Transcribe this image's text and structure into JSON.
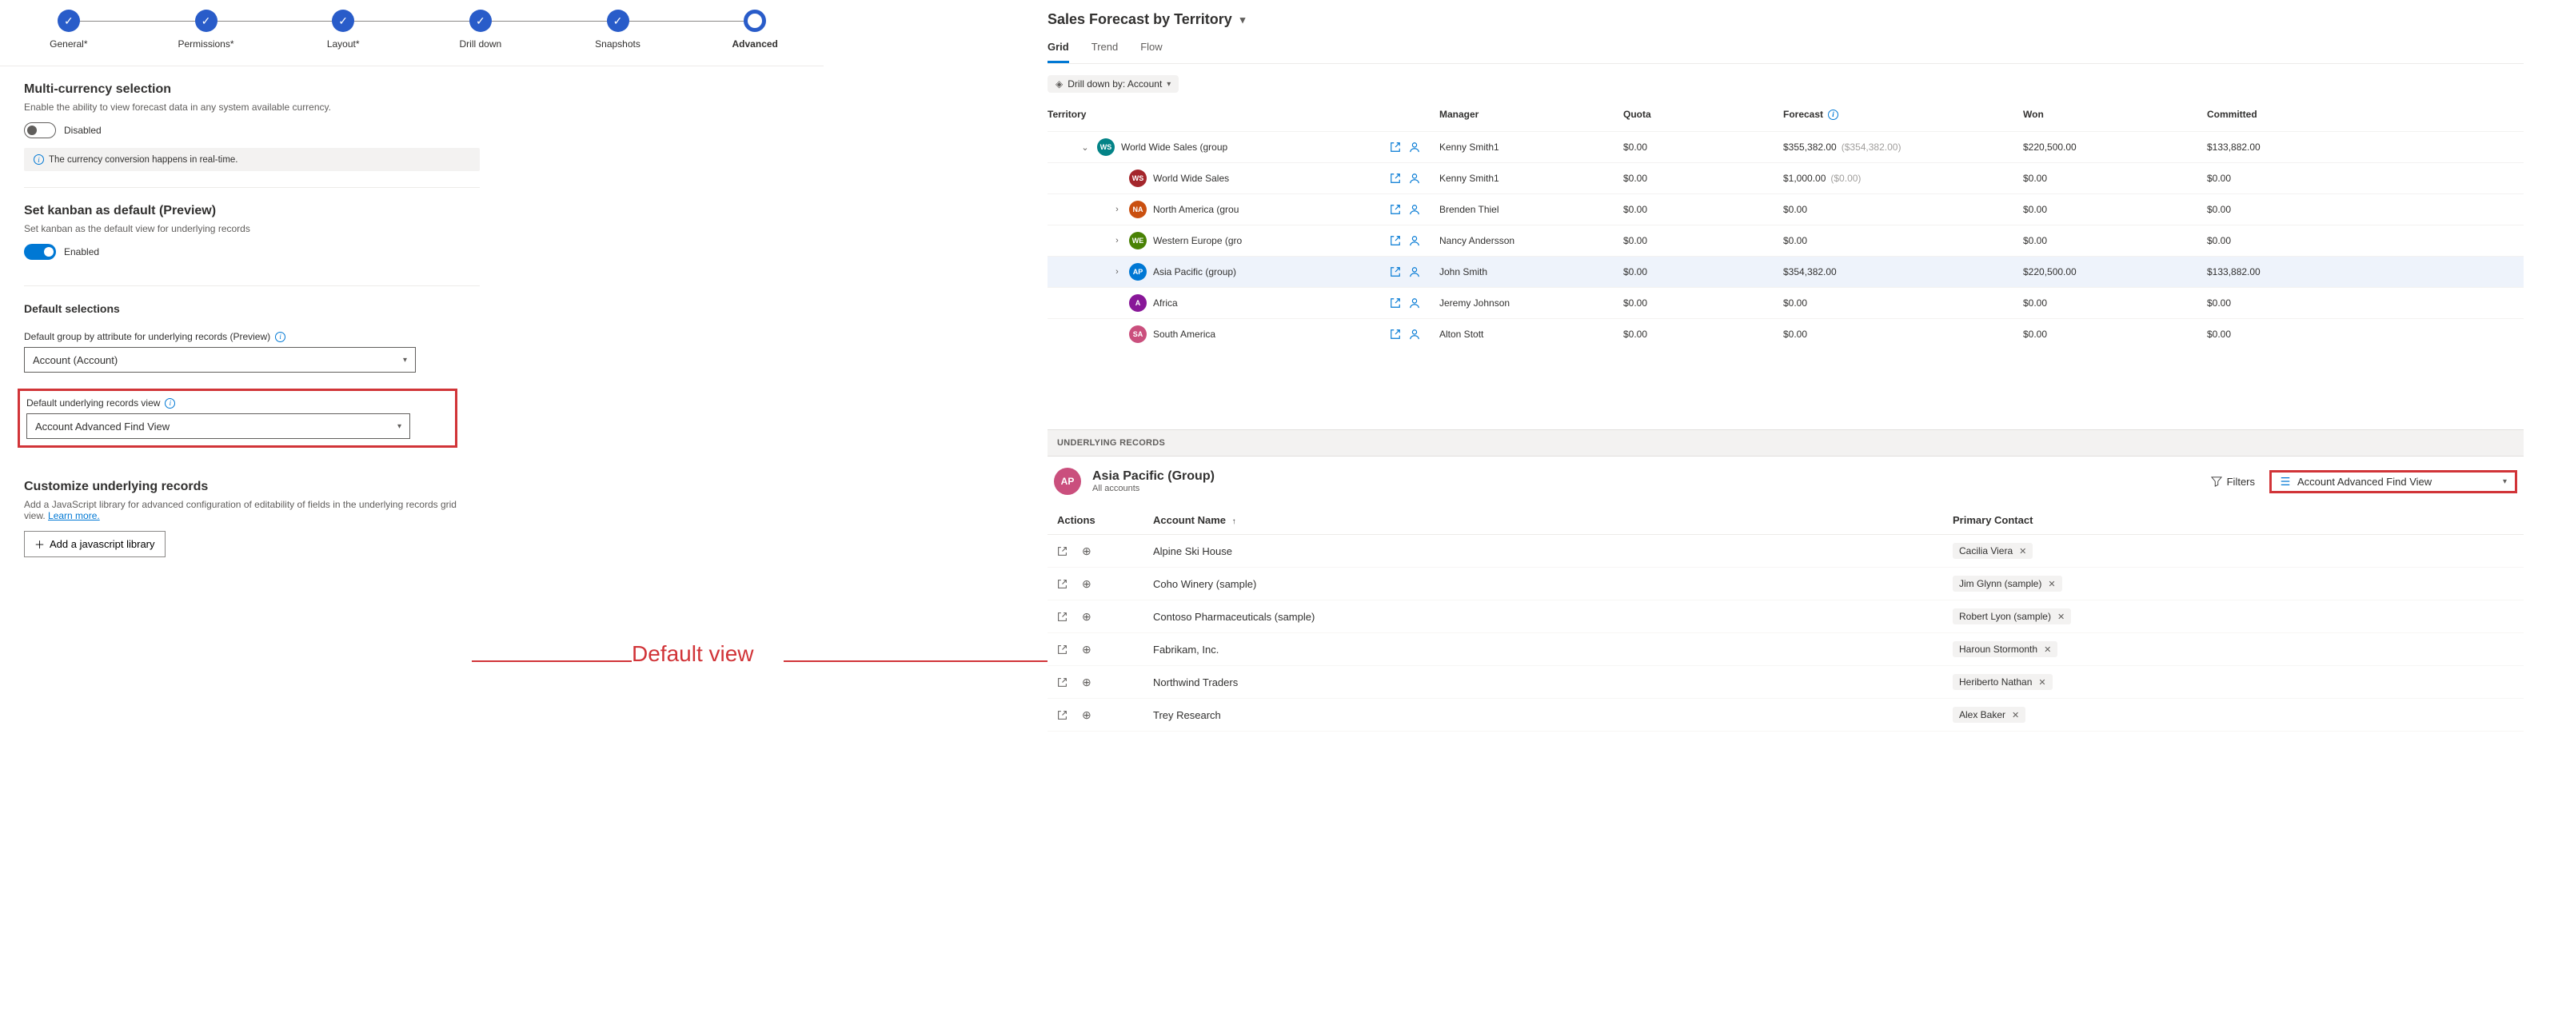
{
  "stepper": {
    "steps": [
      {
        "label": "General*"
      },
      {
        "label": "Permissions*"
      },
      {
        "label": "Layout*"
      },
      {
        "label": "Drill down"
      },
      {
        "label": "Snapshots"
      },
      {
        "label": "Advanced"
      }
    ]
  },
  "multi_currency": {
    "title": "Multi-currency selection",
    "desc": "Enable the ability to view forecast data in any system available currency.",
    "toggle_label": "Disabled",
    "info": "The currency conversion happens in real-time."
  },
  "kanban": {
    "title": "Set kanban as default (Preview)",
    "desc": "Set kanban as the default view for underlying records",
    "toggle_label": "Enabled"
  },
  "default_selections": {
    "title": "Default selections",
    "group_label": "Default group by attribute for underlying records (Preview)",
    "group_value": "Account (Account)",
    "view_label": "Default underlying records view",
    "view_value": "Account Advanced Find View"
  },
  "customize": {
    "title": "Customize underlying records",
    "desc_pre": "Add a JavaScript library for advanced configuration of editability of fields in the underlying records grid view. ",
    "learn_more": "Learn more.",
    "button": "Add a javascript library"
  },
  "annotation": {
    "label": "Default view"
  },
  "forecast": {
    "title": "Sales Forecast by Territory",
    "tabs": {
      "grid": "Grid",
      "trend": "Trend",
      "flow": "Flow"
    },
    "drill_pill": "Drill down by: Account",
    "columns": {
      "territory": "Territory",
      "manager": "Manager",
      "quota": "Quota",
      "forecast": "Forecast",
      "won": "Won",
      "committed": "Committed"
    },
    "rows": [
      {
        "indent": 0,
        "chev": "down",
        "initials": "WS",
        "color": "#038387",
        "name": "World Wide Sales (group",
        "manager": "Kenny Smith1",
        "quota": "$0.00",
        "forecast": "$355,382.00",
        "forecast2": "($354,382.00)",
        "won": "$220,500.00",
        "committed": "$133,882.00"
      },
      {
        "indent": 1,
        "chev": "",
        "initials": "WS",
        "color": "#a4262c",
        "name": "World Wide Sales",
        "manager": "Kenny Smith1",
        "quota": "$0.00",
        "forecast": "$1,000.00",
        "forecast2": "($0.00)",
        "won": "$0.00",
        "committed": "$0.00"
      },
      {
        "indent": 1,
        "chev": "right",
        "initials": "NA",
        "color": "#ca5010",
        "name": "North America (grou",
        "manager": "Brenden Thiel",
        "quota": "$0.00",
        "forecast": "$0.00",
        "forecast2": "",
        "won": "$0.00",
        "committed": "$0.00"
      },
      {
        "indent": 1,
        "chev": "right",
        "initials": "WE",
        "color": "#498205",
        "name": "Western Europe (gro",
        "manager": "Nancy Andersson",
        "quota": "$0.00",
        "forecast": "$0.00",
        "forecast2": "",
        "won": "$0.00",
        "committed": "$0.00"
      },
      {
        "indent": 1,
        "chev": "right",
        "initials": "AP",
        "color": "#0078d4",
        "name": "Asia Pacific (group)",
        "manager": "John Smith",
        "quota": "$0.00",
        "forecast": "$354,382.00",
        "forecast2": "",
        "won": "$220,500.00",
        "committed": "$133,882.00",
        "selected": true
      },
      {
        "indent": 1,
        "chev": "",
        "initials": "A",
        "color": "#881798",
        "name": "Africa",
        "manager": "Jeremy Johnson",
        "quota": "$0.00",
        "forecast": "$0.00",
        "forecast2": "",
        "won": "$0.00",
        "committed": "$0.00"
      },
      {
        "indent": 1,
        "chev": "",
        "initials": "SA",
        "color": "#ca4f7d",
        "name": "South America",
        "manager": "Alton Stott",
        "quota": "$0.00",
        "forecast": "$0.00",
        "forecast2": "",
        "won": "$0.00",
        "committed": "$0.00"
      }
    ]
  },
  "underlying": {
    "header": "UNDERLYING RECORDS",
    "avatar_initials": "AP",
    "title": "Asia Pacific (Group)",
    "subtitle": "All accounts",
    "filters": "Filters",
    "view": "Account Advanced Find View",
    "columns": {
      "actions": "Actions",
      "account": "Account Name",
      "contact": "Primary Contact"
    },
    "rows": [
      {
        "account": "Alpine Ski House",
        "contact": "Cacilia Viera"
      },
      {
        "account": "Coho Winery (sample)",
        "contact": "Jim Glynn (sample)"
      },
      {
        "account": "Contoso Pharmaceuticals (sample)",
        "contact": "Robert Lyon (sample)"
      },
      {
        "account": "Fabrikam, Inc.",
        "contact": "Haroun Stormonth"
      },
      {
        "account": "Northwind Traders",
        "contact": "Heriberto Nathan"
      },
      {
        "account": "Trey Research",
        "contact": "Alex Baker"
      }
    ]
  }
}
